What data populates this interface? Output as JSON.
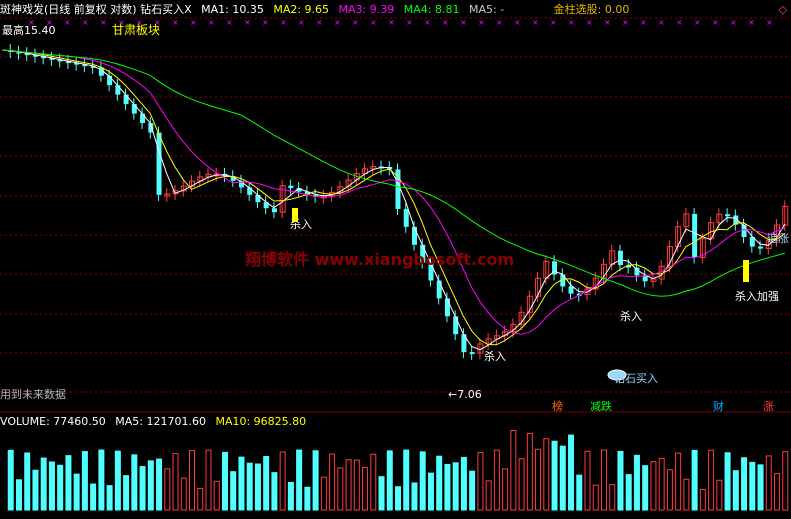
{
  "colors": {
    "bg": "#000000",
    "up": "#ff3c3c",
    "down": "#52ffff",
    "ma1": "#ffffff",
    "ma2": "#ffff00",
    "ma3": "#ff00ff",
    "ma4": "#00ff00",
    "ma5": "#9e9e9e",
    "grid": "#8b0000",
    "watermark": "#8b0000",
    "gold": "#e6b800"
  },
  "header": {
    "title": "斑神戏发(日线 前复权 对数) 钻石买入X",
    "ma1": "MA1: 10.35",
    "ma2": "MA2: 9.65",
    "ma3": "MA3: 9.39",
    "ma4": "MA4: 8.81",
    "ma5": "MA5: -",
    "gold": "金柱选股: 0.00",
    "corner_icon": "diamond-icon"
  },
  "annotations": {
    "high_label": "最高",
    "high_value": "15.40",
    "board": "甘肃板块",
    "low_value": "7.06",
    "diamond": "钻石买入",
    "buy1": "杀入",
    "buy2": "杀入",
    "buy3": "杀入",
    "add": "杀入加强",
    "chase": "追涨",
    "future": "用到未来数据",
    "watermark": "翔博软件 www.xiangbosoft.com"
  },
  "badges": [
    {
      "text": "榜",
      "color": "#ff6a00"
    },
    {
      "text": "减跌",
      "color": "#00ff00"
    },
    {
      "text": "财",
      "color": "#00aaff"
    },
    {
      "text": "涨",
      "color": "#ff3c3c"
    }
  ],
  "volume_header": {
    "volume": "VOLUME: 77460.50",
    "ma5": "MA5: 121701.60",
    "ma10": "MA10: 96825.80"
  },
  "chart_data": {
    "type": "candlestick",
    "price_range": {
      "high": 15.4,
      "low": 7.06
    }
  }
}
